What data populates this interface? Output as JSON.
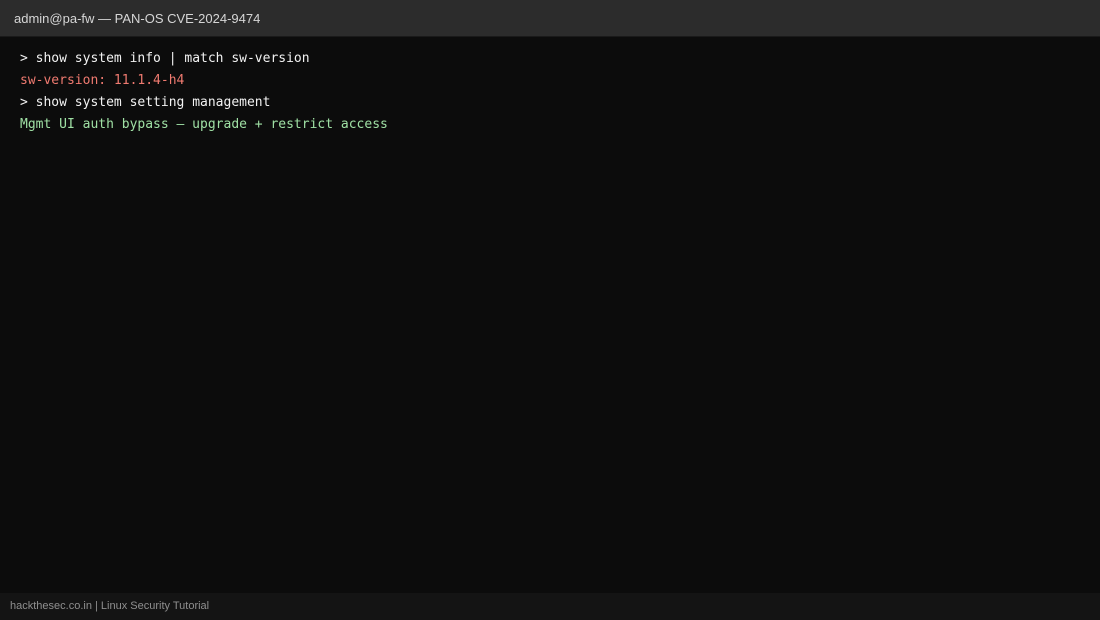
{
  "window": {
    "title": "admin@pa-fw — PAN-OS CVE-2024-9474"
  },
  "terminal": {
    "lines": [
      {
        "prompt": ">",
        "text": "show system info | match sw-version",
        "kind": "command"
      },
      {
        "text": "sw-version: 11.1.4-h4",
        "kind": "output-error"
      },
      {
        "prompt": ">",
        "text": "show system setting management",
        "kind": "command"
      },
      {
        "text": "Mgmt UI auth bypass — upgrade + restrict access",
        "kind": "output-success"
      }
    ]
  },
  "statusbar": {
    "text": "hackthesec.co.in | Linux Security Tutorial"
  },
  "colors": {
    "background": "#0c0c0c",
    "titlebar": "#2c2c2c",
    "command": "#f2f2f2",
    "error_output": "#ef7a70",
    "success_output": "#9fe0a4"
  }
}
